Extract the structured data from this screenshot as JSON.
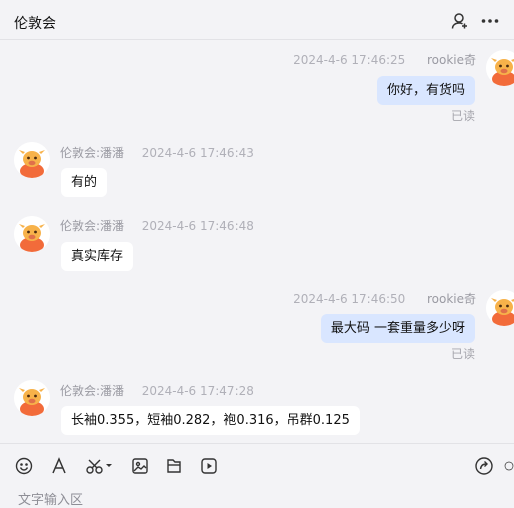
{
  "header": {
    "title": "伦敦会"
  },
  "messages": [
    {
      "direction": "out",
      "sender": "rookie奇",
      "time": "2024-4-6 17:46:25",
      "text": "你好，有货吗",
      "status": "已读"
    },
    {
      "direction": "in",
      "sender": "伦敦会:潘潘",
      "time": "2024-4-6 17:46:43",
      "text": "有的"
    },
    {
      "direction": "in",
      "sender": "伦敦会:潘潘",
      "time": "2024-4-6 17:46:48",
      "text": "真实库存"
    },
    {
      "direction": "out",
      "sender": "rookie奇",
      "time": "2024-4-6 17:46:50",
      "text": "最大码 一套重量多少呀",
      "status": "已读"
    },
    {
      "direction": "in",
      "sender": "伦敦会:潘潘",
      "time": "2024-4-6 17:47:28",
      "text": "长袖0.355，短袖0.282，袍0.316，吊群0.125"
    }
  ],
  "toolbar": {
    "icons": [
      "emoji-icon",
      "font-icon",
      "scissors-icon",
      "image-icon",
      "file-icon",
      "video-icon",
      "share-icon"
    ]
  },
  "input": {
    "placeholder": "文字输入区"
  },
  "colors": {
    "background": "#f3f3f6",
    "bubble_out": "#d9e6ff",
    "bubble_in": "#ffffff",
    "avatar_orange": "#f26b3a"
  }
}
